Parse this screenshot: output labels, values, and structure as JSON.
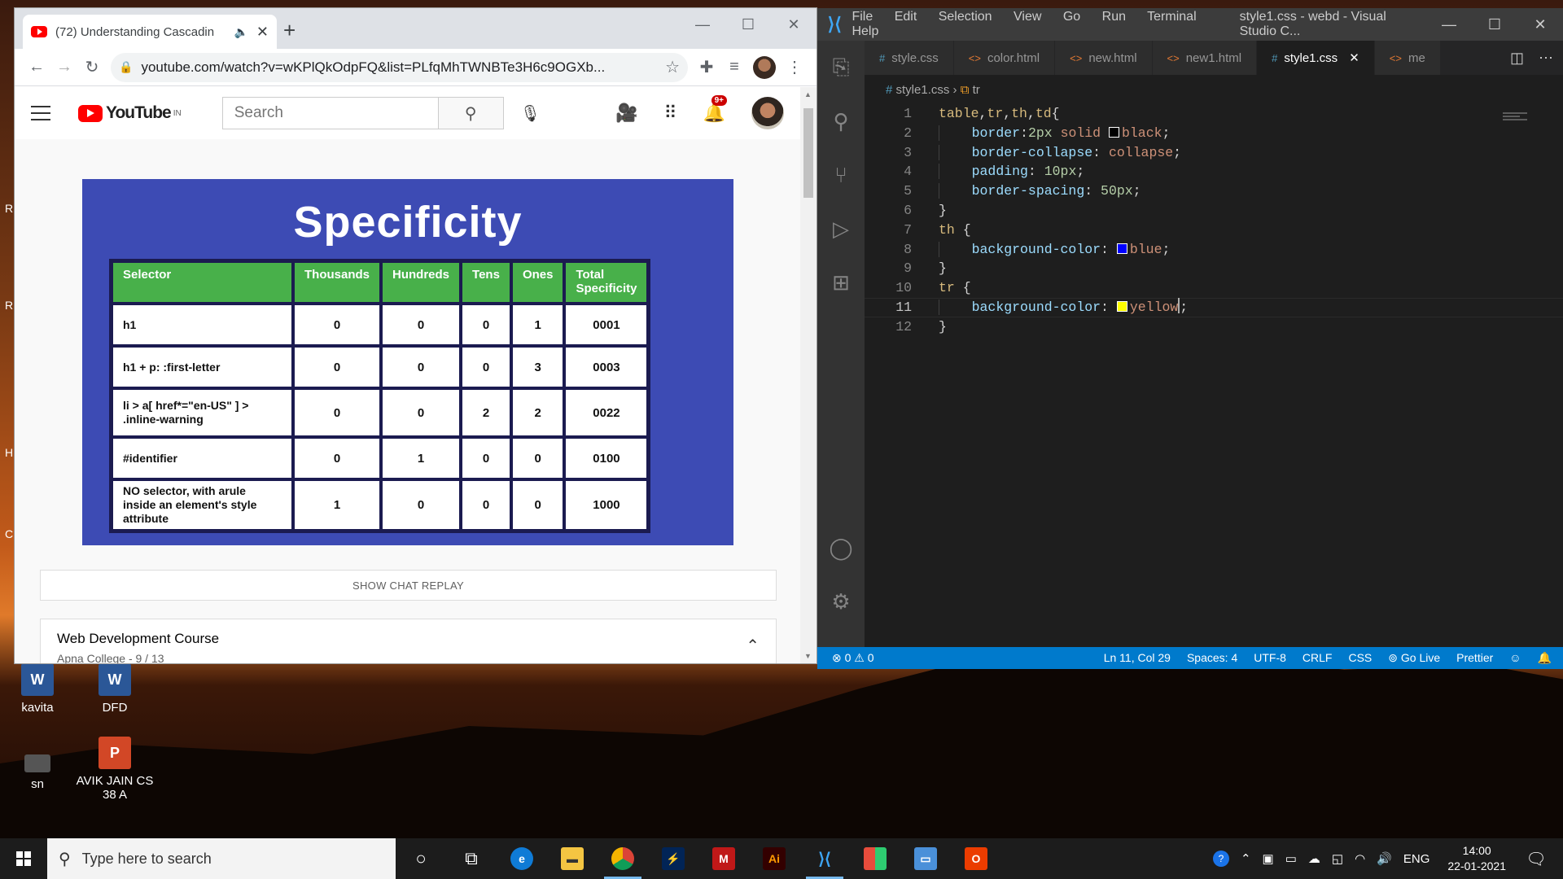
{
  "desktop": {
    "icons": [
      {
        "label": "kavita"
      },
      {
        "label": "DFD"
      },
      {
        "label": "sn"
      },
      {
        "label": "AVIK JAIN CS 38 A"
      }
    ]
  },
  "chrome": {
    "tab_title": "(72) Understanding Cascadin",
    "url": "youtube.com/watch?v=wKPlQkOdpFQ&list=PLfqMhTWNBTe3H6c9OGXb...",
    "youtube": {
      "logo_text": "YouTube",
      "country": "IN",
      "search_placeholder": "Search",
      "notification_count": "9+",
      "slide": {
        "title": "Specificity",
        "headers": [
          "Selector",
          "Thousands",
          "Hundreds",
          "Tens",
          "Ones",
          "Total Specificity"
        ],
        "rows": [
          [
            "h1",
            "0",
            "0",
            "0",
            "1",
            "0001"
          ],
          [
            "h1 + p: :first-letter",
            "0",
            "0",
            "0",
            "3",
            "0003"
          ],
          [
            "li > a[ href*=\"en-US\" ] > .inline-warning",
            "0",
            "0",
            "2",
            "2",
            "0022"
          ],
          [
            "#identifier",
            "0",
            "1",
            "0",
            "0",
            "0100"
          ],
          [
            "NO selector, with arule inside an element's style attribute",
            "1",
            "0",
            "0",
            "0",
            "1000"
          ]
        ]
      },
      "chat_replay": "SHOW CHAT REPLAY",
      "playlist_title": "Web Development Course",
      "playlist_sub": "Apna College - 9 / 13"
    }
  },
  "vscode": {
    "menu": [
      "File",
      "Edit",
      "Selection",
      "View",
      "Go",
      "Run",
      "Terminal",
      "Help"
    ],
    "window_title": "style1.css - webd - Visual Studio C...",
    "tabs": [
      "style.css",
      "color.html",
      "new.html",
      "new1.html",
      "style1.css",
      "me"
    ],
    "breadcrumb_file": "style1.css",
    "breadcrumb_symbol": "tr",
    "status": {
      "problems": "⊗ 0 ⚠ 0",
      "position": "Ln 11, Col 29",
      "spaces": "Spaces: 4",
      "encoding": "UTF-8",
      "eol": "CRLF",
      "language": "CSS",
      "golive": "Go Live",
      "formatter": "Prettier"
    }
  },
  "taskbar": {
    "search_placeholder": "Type here to search",
    "language": "ENG",
    "time": "14:00",
    "date": "22-01-2021"
  },
  "colors": {
    "slide_bg": "#3d4bb4",
    "header_green": "#48b04a",
    "vscode_status": "#007acc"
  }
}
